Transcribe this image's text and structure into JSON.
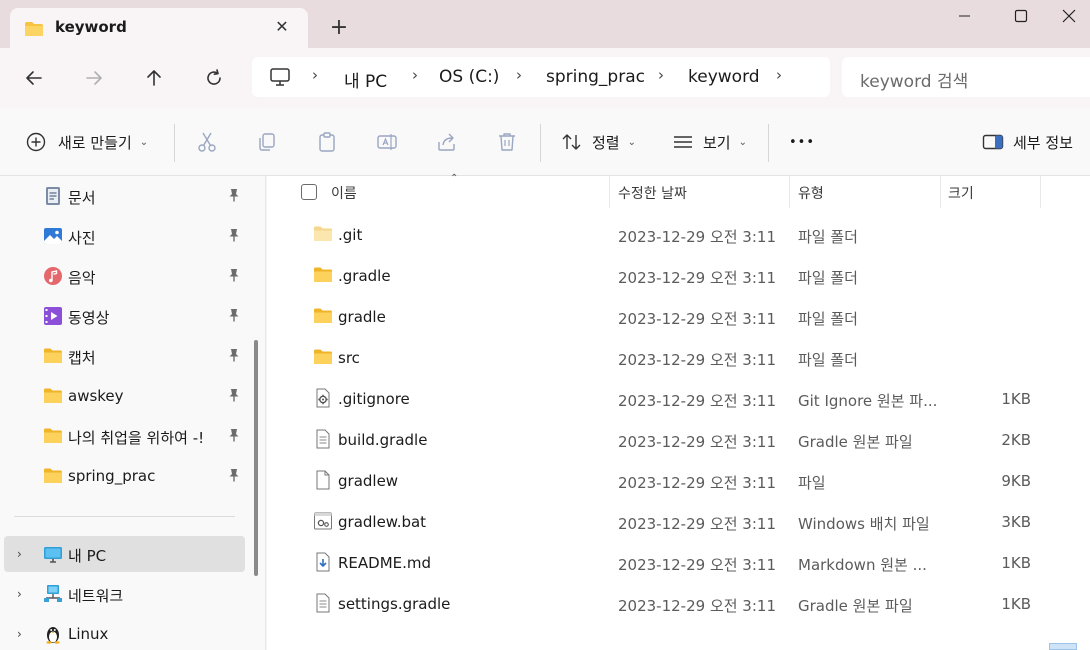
{
  "window": {
    "tab_title": "keyword",
    "tab_close": "✕",
    "new_tab": "+",
    "minimize": "—",
    "maximize": "☐",
    "close": "✕"
  },
  "address": {
    "crumbs": [
      "내 PC",
      "OS (C:)",
      "spring_prac",
      "keyword"
    ],
    "separator": "›",
    "search_placeholder": "keyword 검색"
  },
  "commands": {
    "new_label": "새로 만들기",
    "sort_label": "정렬",
    "view_label": "보기",
    "more_label": "•••",
    "details_label": "세부 정보"
  },
  "sidebar": {
    "quick": [
      {
        "label": "문서",
        "icon": "documents-icon"
      },
      {
        "label": "사진",
        "icon": "pictures-icon"
      },
      {
        "label": "음악",
        "icon": "music-icon"
      },
      {
        "label": "동영상",
        "icon": "videos-icon"
      },
      {
        "label": "캡처",
        "icon": "folder-icon"
      },
      {
        "label": "awskey",
        "icon": "folder-icon"
      },
      {
        "label": "나의 취업을 위하여 -!",
        "icon": "folder-icon"
      },
      {
        "label": "spring_prac",
        "icon": "folder-icon"
      }
    ],
    "tree": [
      {
        "label": "내 PC",
        "icon": "pc-icon",
        "selected": true
      },
      {
        "label": "네트워크",
        "icon": "network-icon",
        "selected": false
      },
      {
        "label": "Linux",
        "icon": "linux-icon",
        "selected": false
      }
    ]
  },
  "columns": {
    "name": "이름",
    "date": "수정한 날짜",
    "type": "유형",
    "size": "크기"
  },
  "files": [
    {
      "name": ".git",
      "date": "2023-12-29 오전 3:11",
      "type": "파일 폴더",
      "size": "",
      "kind": "folder-light"
    },
    {
      "name": ".gradle",
      "date": "2023-12-29 오전 3:11",
      "type": "파일 폴더",
      "size": "",
      "kind": "folder"
    },
    {
      "name": "gradle",
      "date": "2023-12-29 오전 3:11",
      "type": "파일 폴더",
      "size": "",
      "kind": "folder"
    },
    {
      "name": "src",
      "date": "2023-12-29 오전 3:11",
      "type": "파일 폴더",
      "size": "",
      "kind": "folder"
    },
    {
      "name": ".gitignore",
      "date": "2023-12-29 오전 3:11",
      "type": "Git Ignore 원본 파...",
      "size": "1KB",
      "kind": "config"
    },
    {
      "name": "build.gradle",
      "date": "2023-12-29 오전 3:11",
      "type": "Gradle 원본 파일",
      "size": "2KB",
      "kind": "text"
    },
    {
      "name": "gradlew",
      "date": "2023-12-29 오전 3:11",
      "type": "파일",
      "size": "9KB",
      "kind": "blank"
    },
    {
      "name": "gradlew.bat",
      "date": "2023-12-29 오전 3:11",
      "type": "Windows 배치 파일",
      "size": "3KB",
      "kind": "batch"
    },
    {
      "name": "README.md",
      "date": "2023-12-29 오전 3:11",
      "type": "Markdown 원본 ...",
      "size": "1KB",
      "kind": "markdown"
    },
    {
      "name": "settings.gradle",
      "date": "2023-12-29 오전 3:11",
      "type": "Gradle 원본 파일",
      "size": "1KB",
      "kind": "text"
    }
  ],
  "colors": {
    "titlebar": "#e8dcdf",
    "folder": "#f8c33f",
    "selection": "#e0e0e0"
  }
}
